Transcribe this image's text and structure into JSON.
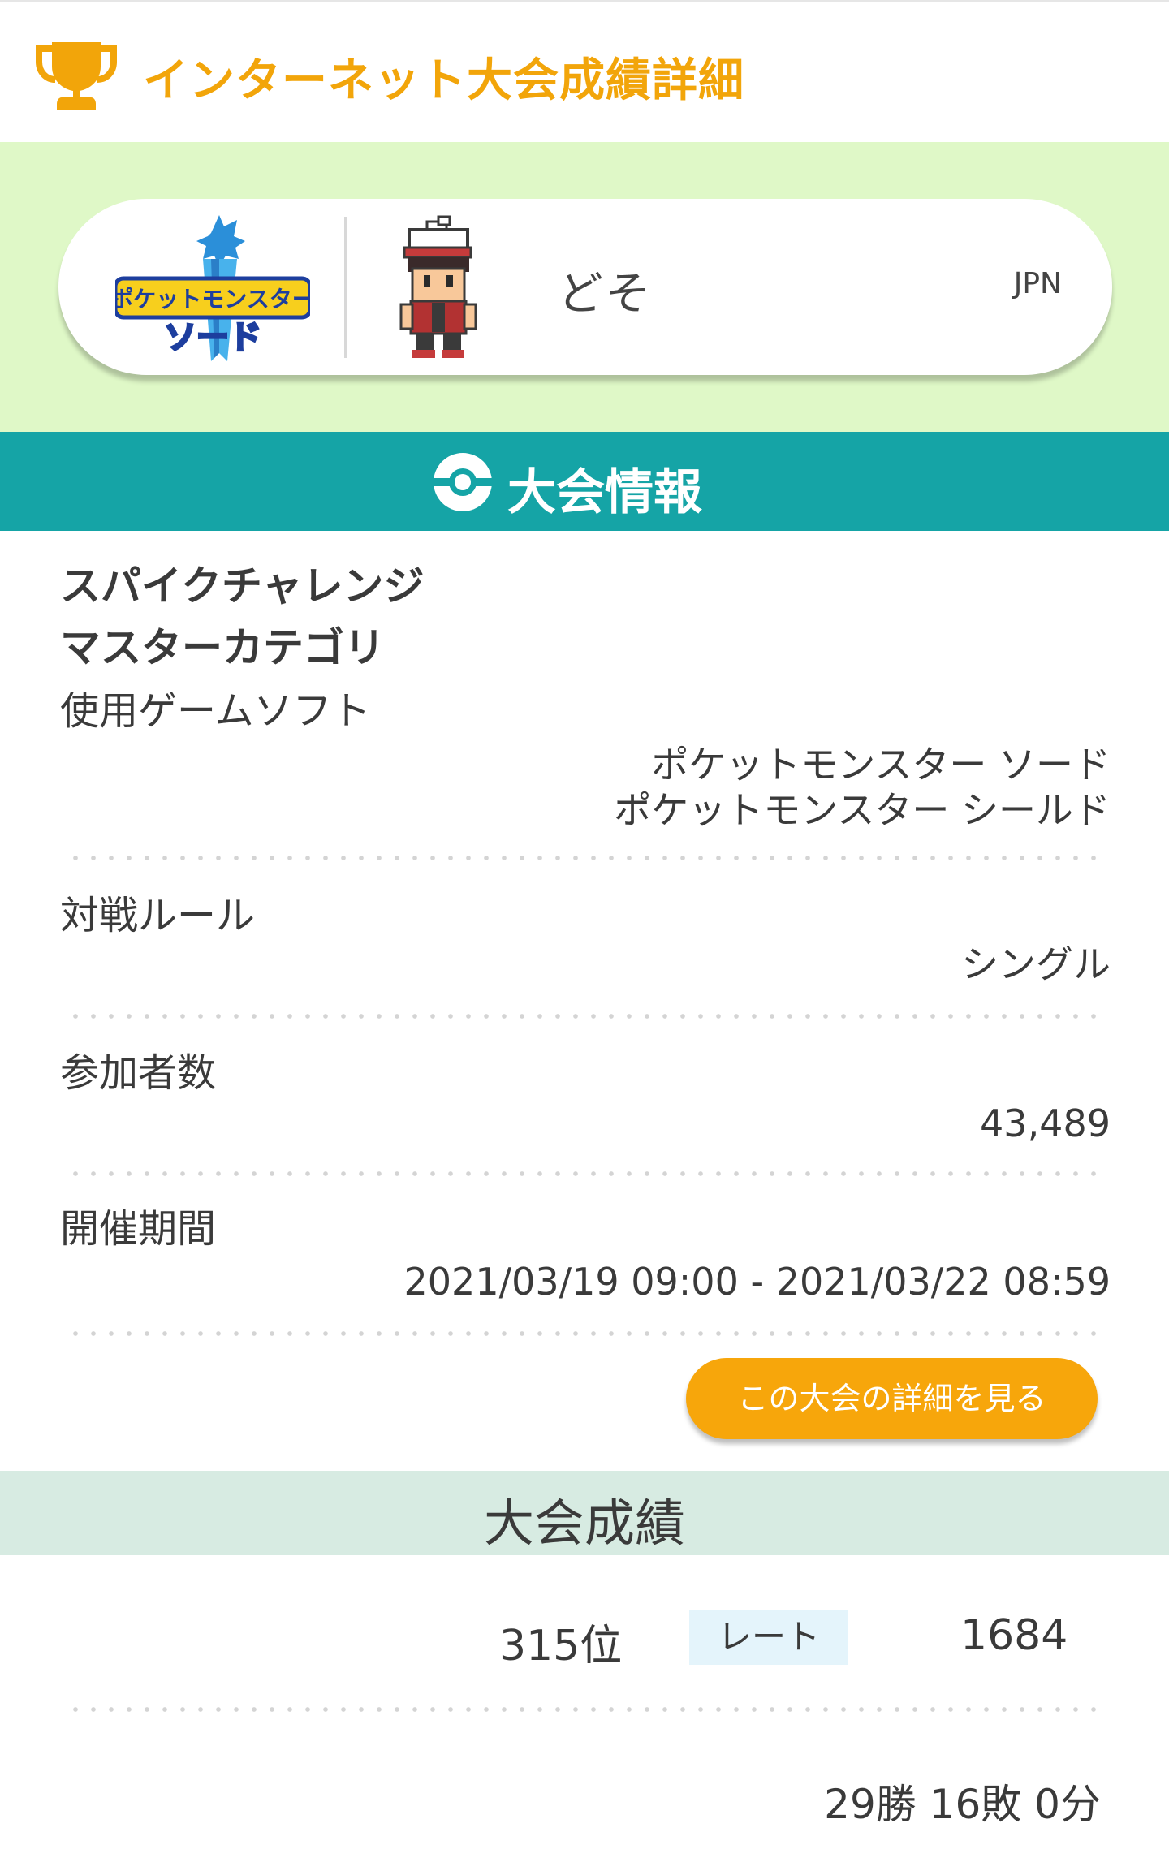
{
  "header": {
    "title": "インターネット大会成績詳細",
    "icon": "trophy-icon",
    "accent": "#f2a50a"
  },
  "profile": {
    "game_logo_text": "ポケットモンスター ソード",
    "player_name": "どそ",
    "region": "JPN"
  },
  "tournament_info": {
    "section_title": "大会情報",
    "name_line1": "スパイクチャレンジ",
    "name_line2": "マスターカテゴリ",
    "game_software_label": "使用ゲームソフト",
    "game_software_1": "ポケットモンスター ソード",
    "game_software_2": "ポケットモンスター シールド",
    "battle_rule_label": "対戦ルール",
    "battle_rule_value": "シングル",
    "participants_label": "参加者数",
    "participants_value": "43,489",
    "period_label": "開催期間",
    "period_value": "2021/03/19 09:00 - 2021/03/22 08:59",
    "detail_button": "この大会の詳細を見る"
  },
  "results": {
    "section_title": "大会成績",
    "rank": "315位",
    "rate_label": "レート",
    "rate_value": "1684",
    "record": "29勝 16敗 0分"
  },
  "colors": {
    "profile_bg": "#dff8c7",
    "section_bar": "#15a4a6",
    "result_bar": "#d7ebe2",
    "button": "#f7a60b",
    "rate_badge": "#e4f4fb"
  }
}
